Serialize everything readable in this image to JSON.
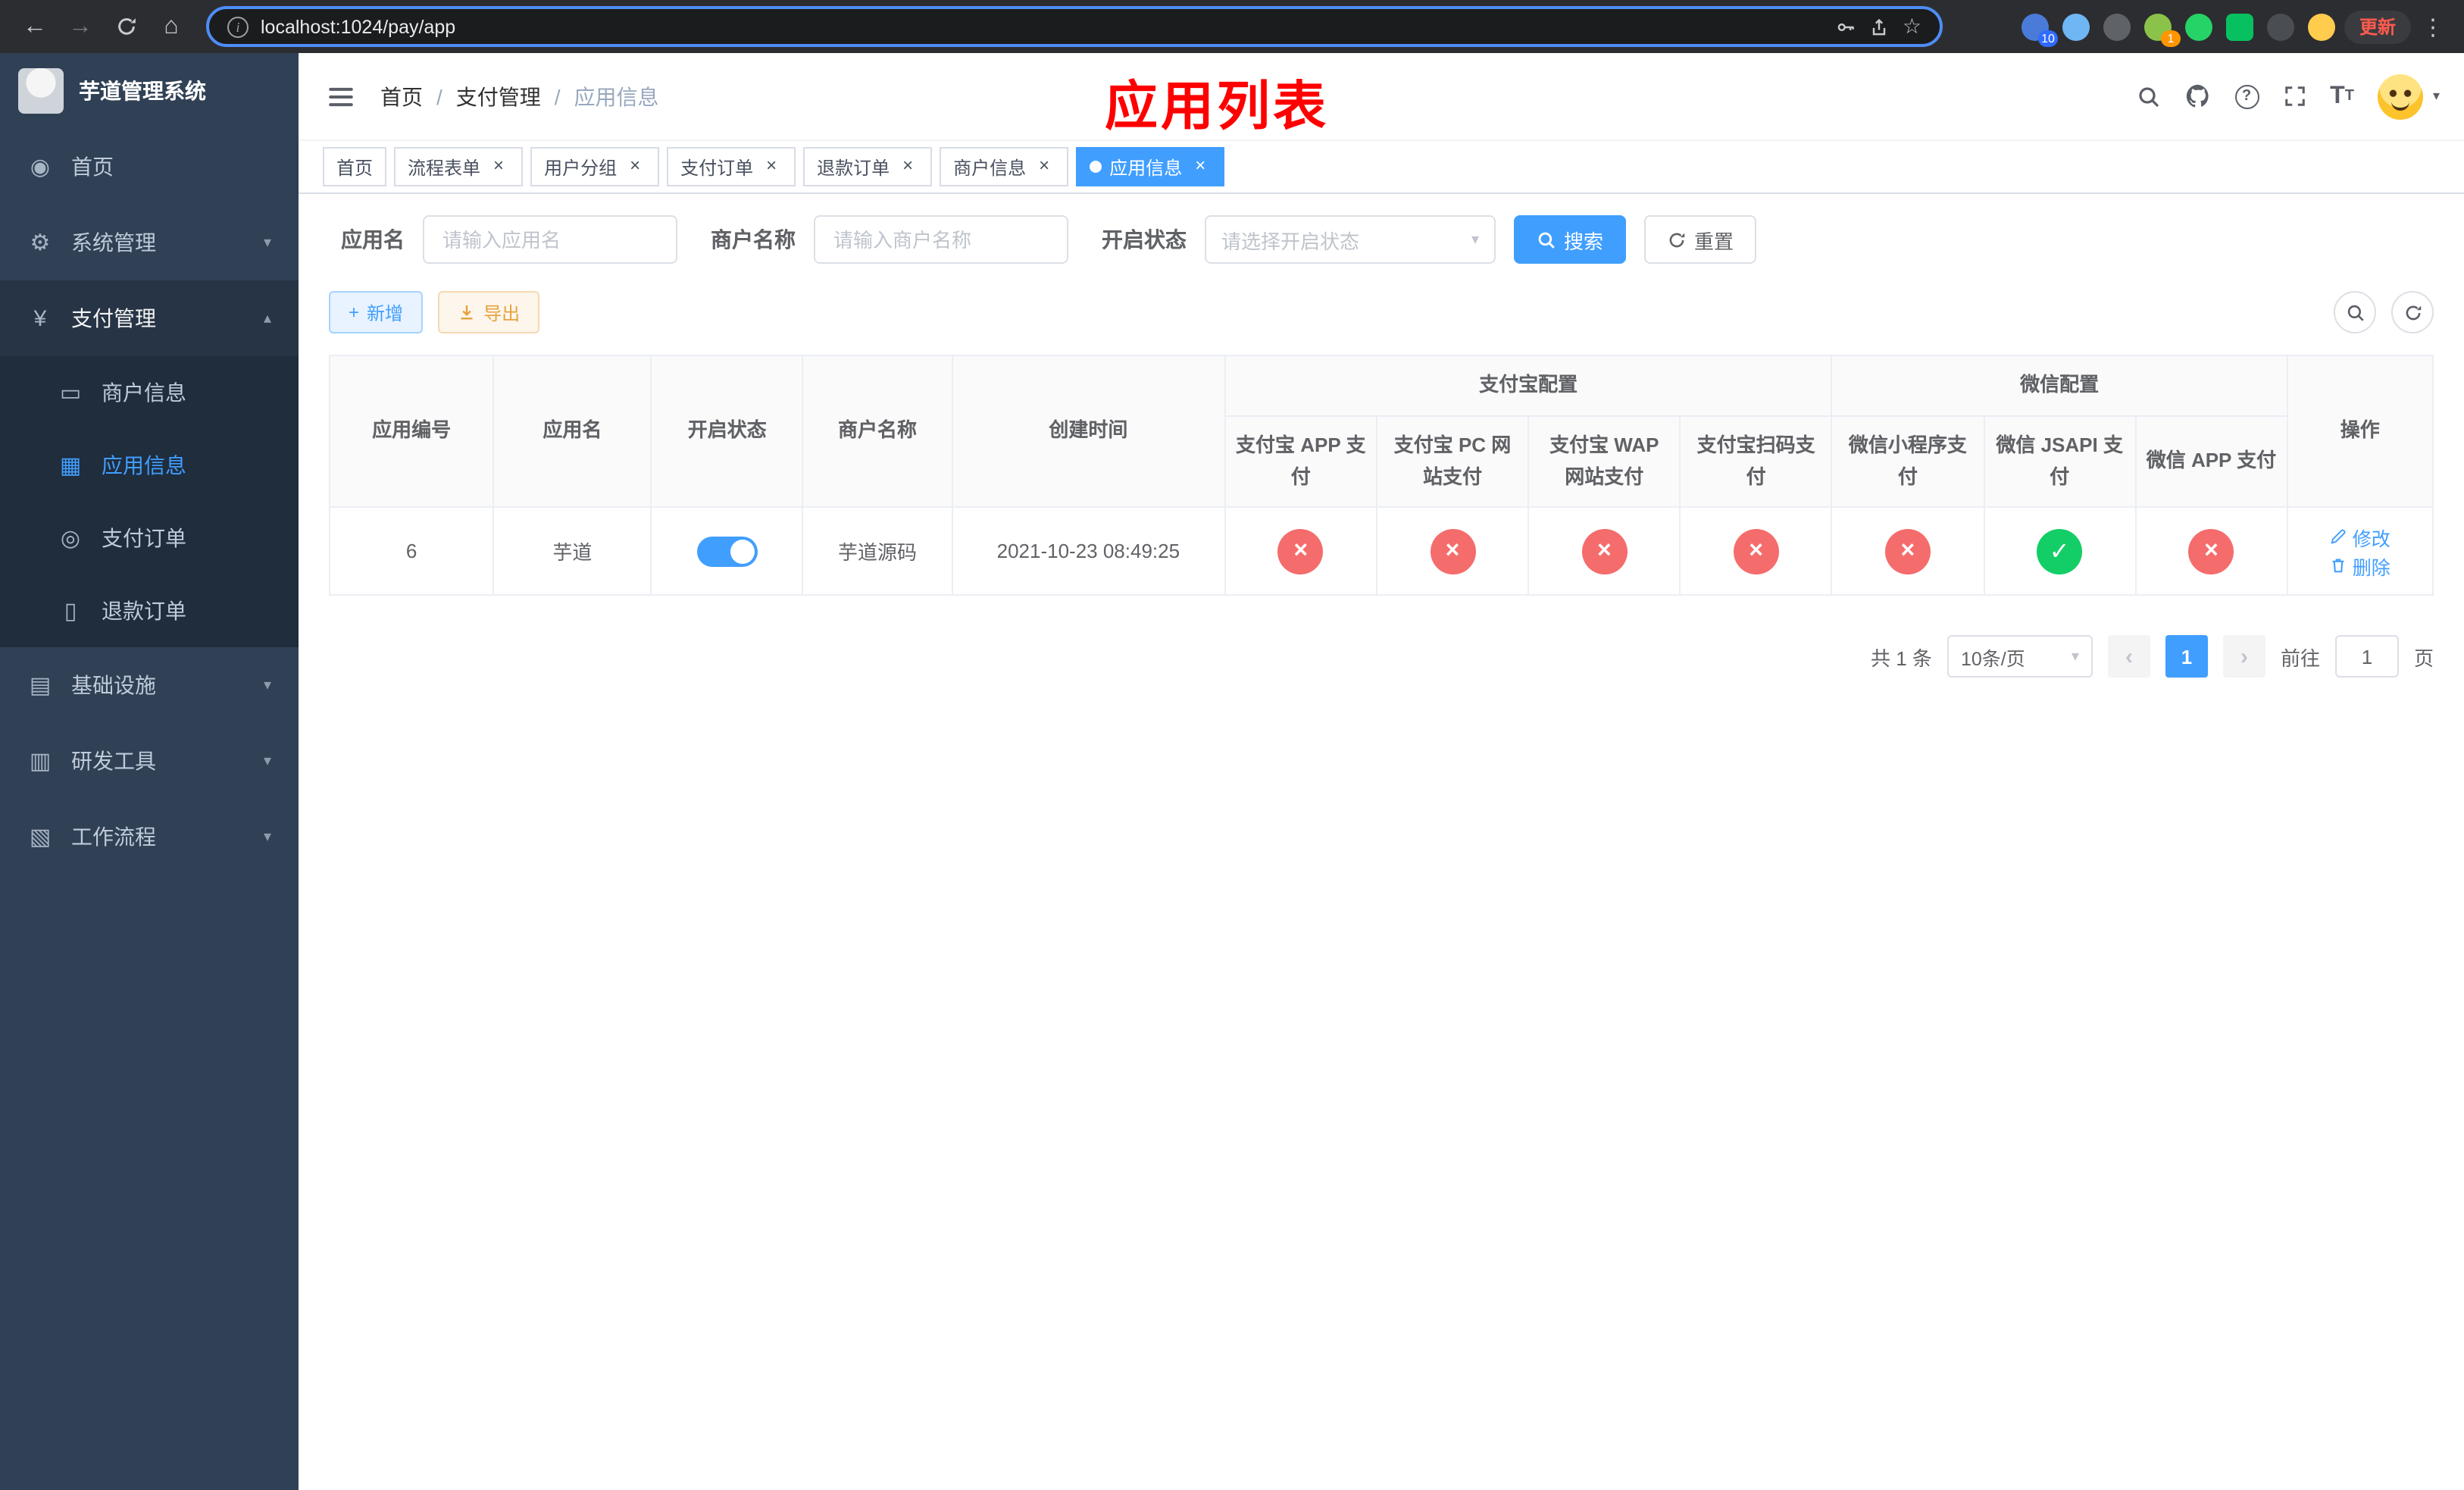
{
  "colors": {
    "accent": "#409eff",
    "success": "#13ce66",
    "danger": "#f56c6c",
    "warning": "#e6a23c",
    "sidebar_bg": "#304156",
    "submenu_bg": "#1f2d3d",
    "active_tab": "#409eff",
    "title_red": "#fe0000"
  },
  "browser": {
    "url": "localhost:1024/pay/app",
    "update_button": "更新",
    "extensions": [
      {
        "name": "extension-blue-badge-icon",
        "color": "#4a7bd8",
        "badge": "10",
        "badge_color": "#2f6bff"
      },
      {
        "name": "extension-drop-icon",
        "color": "#6fb6f5"
      },
      {
        "name": "extension-dark-circle-icon",
        "color": "#5f6368"
      },
      {
        "name": "extension-green-avatar-icon",
        "color": "#8bc34a",
        "badge": "1",
        "badge_color": "#ff9500"
      },
      {
        "name": "extension-green-circle-icon",
        "color": "#25d366"
      },
      {
        "name": "extension-green-square-icon",
        "color": "#07c160",
        "shape": "square"
      },
      {
        "name": "extension-pin-icon",
        "color": "#4a4d52"
      },
      {
        "name": "extension-smiley-icon",
        "color": "#ffcc4d"
      }
    ]
  },
  "sidebar": {
    "logo_title": "芋道管理系统",
    "items": [
      {
        "label": "首页"
      },
      {
        "label": "系统管理"
      },
      {
        "label": "支付管理"
      },
      {
        "label": "基础设施"
      },
      {
        "label": "研发工具"
      },
      {
        "label": "工作流程"
      }
    ],
    "pay_children": [
      {
        "label": "商户信息"
      },
      {
        "label": "应用信息"
      },
      {
        "label": "支付订单"
      },
      {
        "label": "退款订单"
      }
    ]
  },
  "header": {
    "breadcrumb": [
      "首页",
      "支付管理",
      "应用信息"
    ],
    "overlay_title": "应用列表"
  },
  "tabs": [
    {
      "label": "首页"
    },
    {
      "label": "流程表单"
    },
    {
      "label": "用户分组"
    },
    {
      "label": "支付订单"
    },
    {
      "label": "退款订单"
    },
    {
      "label": "商户信息"
    },
    {
      "label": "应用信息"
    }
  ],
  "filters": {
    "app_name_label": "应用名",
    "app_name_placeholder": "请输入应用名",
    "merchant_label": "商户名称",
    "merchant_placeholder": "请输入商户名称",
    "status_label": "开启状态",
    "status_placeholder": "请选择开启状态",
    "search_button": "搜索",
    "reset_button": "重置"
  },
  "toolbar": {
    "add_button": "新增",
    "export_button": "导出"
  },
  "table": {
    "columns": [
      "应用编号",
      "应用名",
      "开启状态",
      "商户名称",
      "创建时间"
    ],
    "alipay_group": "支付宝配置",
    "alipay_columns": [
      "支付宝 APP 支付",
      "支付宝 PC 网站支付",
      "支付宝 WAP 网站支付",
      "支付宝扫码支付"
    ],
    "wechat_group": "微信配置",
    "wechat_columns": [
      "微信小程序支付",
      "微信 JSAPI 支付",
      "微信 APP 支付"
    ],
    "action_column": "操作",
    "edit_label": "修改",
    "delete_label": "删除",
    "rows": [
      {
        "id": "6",
        "name": "芋道",
        "enabled": true,
        "merchant": "芋道源码",
        "created": "2021-10-23 08:49:25",
        "alipay": [
          false,
          false,
          false,
          false
        ],
        "wechat": [
          false,
          true,
          false
        ]
      }
    ]
  },
  "pagination": {
    "total": "共 1 条",
    "page_size": "10条/页",
    "current_page": "1",
    "goto_label": "前往",
    "goto_value": "1",
    "goto_suffix": "页"
  }
}
